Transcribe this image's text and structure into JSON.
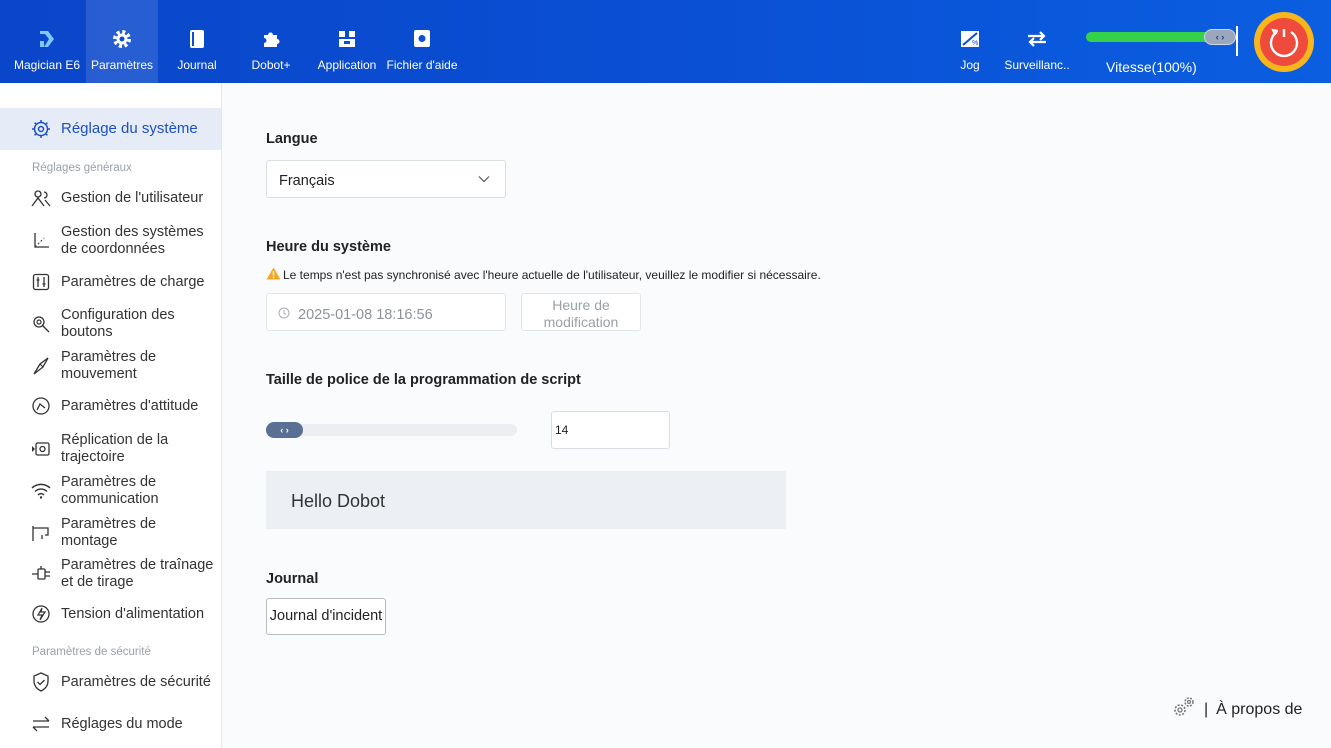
{
  "topbar": {
    "nav": [
      {
        "label": "Magician E6",
        "icon": "dobot-logo-icon"
      },
      {
        "label": "Paramètres",
        "icon": "gear-icon"
      },
      {
        "label": "Journal",
        "icon": "book-icon"
      },
      {
        "label": "Dobot+",
        "icon": "puzzle-icon"
      },
      {
        "label": "Application",
        "icon": "application-icon"
      },
      {
        "label": "Fichier d'aide",
        "icon": "help-file-icon"
      }
    ],
    "right": [
      {
        "label": "Jog",
        "icon": "jog-icon"
      },
      {
        "label": "Surveillanc..",
        "icon": "transfer-icon"
      }
    ],
    "speed": {
      "label": "Vitesse(100%)",
      "value": 1.0
    },
    "colors": {
      "bar": "#0a4fd4",
      "speed_fill": "#35d14a",
      "power_outer": "#f6b61c",
      "power_inner": "#ef4b3c"
    }
  },
  "sidebar": {
    "top_item": {
      "label": "Réglage du système",
      "icon": "gear-outline-icon"
    },
    "section_general": "Réglages généraux",
    "items": [
      {
        "label": "Gestion de l'utilisateur",
        "icon": "users-icon"
      },
      {
        "label": "Gestion des systèmes de coordonnées",
        "icon": "coordinate-axes-icon"
      },
      {
        "label": "Paramètres de charge",
        "icon": "load-icon"
      },
      {
        "label": "Configuration des boutons",
        "icon": "button-config-icon"
      },
      {
        "label": "Paramètres de mouvement",
        "icon": "motion-icon"
      },
      {
        "label": "Paramètres d'attitude",
        "icon": "attitude-icon"
      },
      {
        "label": "Réplication de la trajectoire",
        "icon": "trajectory-icon"
      },
      {
        "label": "Paramètres de communication",
        "icon": "wifi-icon"
      },
      {
        "label": "Paramètres de montage",
        "icon": "mounting-icon"
      },
      {
        "label": "Paramètres de traînage et de tirage",
        "icon": "drag-icon"
      },
      {
        "label": "Tension d'alimentation",
        "icon": "power-supply-icon"
      }
    ],
    "section_security": "Paramètres de sécurité",
    "security_items": [
      {
        "label": "Paramètres de sécurité",
        "icon": "shield-icon"
      },
      {
        "label": "Réglages du mode",
        "icon": "mode-switch-icon"
      }
    ]
  },
  "main": {
    "language": {
      "title": "Langue",
      "value": "Français"
    },
    "system_time": {
      "title": "Heure du système",
      "warning": "Le temps n'est pas synchronisé avec l'heure actuelle de l'utilisateur, veuillez le modifier si nécessaire.",
      "value": "2025-01-08 18:16:56",
      "modify_label": "Heure de modification"
    },
    "font_size": {
      "title": "Taille de police de la programmation de script",
      "value": "14",
      "slider_value": 0.0,
      "preview": "Hello Dobot"
    },
    "journal": {
      "title": "Journal",
      "button": "Journal d'incident"
    },
    "about": {
      "separator": "|",
      "label": "À propos de"
    }
  }
}
